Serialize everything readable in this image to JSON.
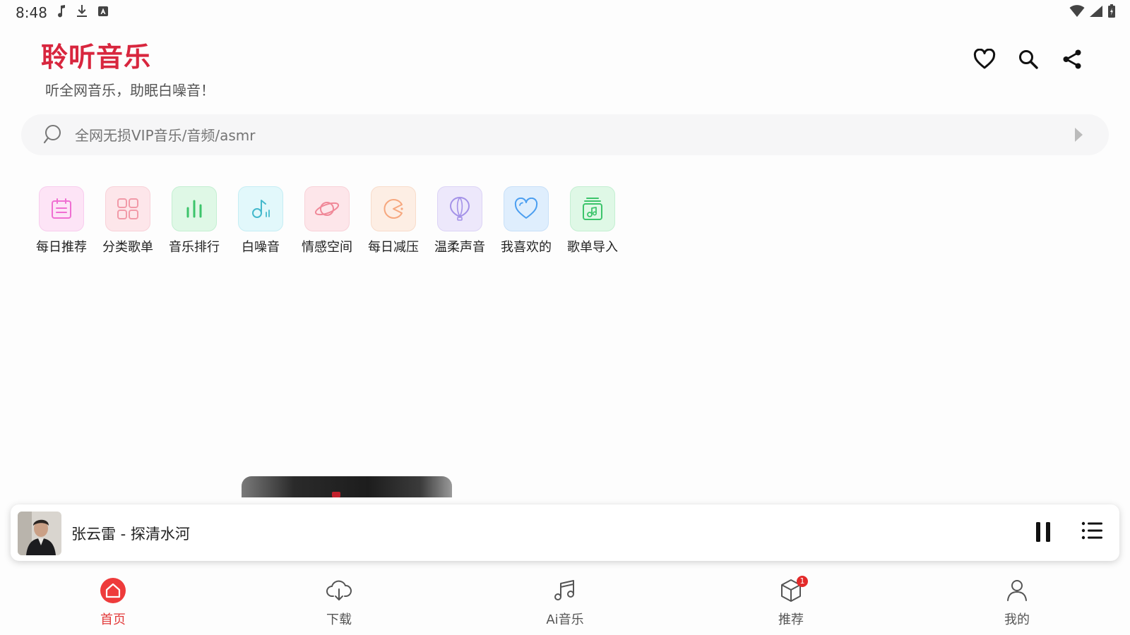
{
  "status_bar": {
    "time": "8:48"
  },
  "header": {
    "title": "聆听音乐",
    "subtitle": "听全网音乐，助眠白噪音！",
    "title_color": "#d8263e"
  },
  "search": {
    "placeholder": "全网无损VIP音乐/音频/asmr"
  },
  "quick_links": [
    {
      "label": "每日推荐",
      "icon": "calendar-icon",
      "bg": "#fde4f6",
      "color": "#f06fd2"
    },
    {
      "label": "分类歌单",
      "icon": "grid-icon",
      "bg": "#fde6ea",
      "color": "#f29aa8"
    },
    {
      "label": "音乐排行",
      "icon": "bar-chart-icon",
      "bg": "#dff8e6",
      "color": "#3cc46b"
    },
    {
      "label": "白噪音",
      "icon": "music-note-icon",
      "bg": "#e2f8fb",
      "color": "#44b9cc"
    },
    {
      "label": "情感空间",
      "icon": "planet-icon",
      "bg": "#fde6ea",
      "color": "#f08898"
    },
    {
      "label": "每日减压",
      "icon": "pacman-icon",
      "bg": "#fdeee4",
      "color": "#f6a77e"
    },
    {
      "label": "温柔声音",
      "icon": "balloon-icon",
      "bg": "#ede8fb",
      "color": "#a492e8"
    },
    {
      "label": "我喜欢的",
      "icon": "heart-icon",
      "bg": "#dfeefd",
      "color": "#4b9ef0"
    },
    {
      "label": "歌单导入",
      "icon": "playlist-import-icon",
      "bg": "#dff8e6",
      "color": "#3cc46b"
    }
  ],
  "player": {
    "now_playing": "张云雷 - 探清水河"
  },
  "bottom_nav": [
    {
      "label": "首页",
      "icon": "home-icon",
      "active": true
    },
    {
      "label": "下载",
      "icon": "cloud-download-icon",
      "active": false
    },
    {
      "label": "Ai音乐",
      "icon": "music-notes-icon",
      "active": false
    },
    {
      "label": "推荐",
      "icon": "cube-icon",
      "active": false,
      "badge": "1"
    },
    {
      "label": "我的",
      "icon": "user-icon",
      "active": false
    }
  ],
  "colors": {
    "accent": "#e23a3a",
    "search_bg": "#f6f6f7"
  }
}
